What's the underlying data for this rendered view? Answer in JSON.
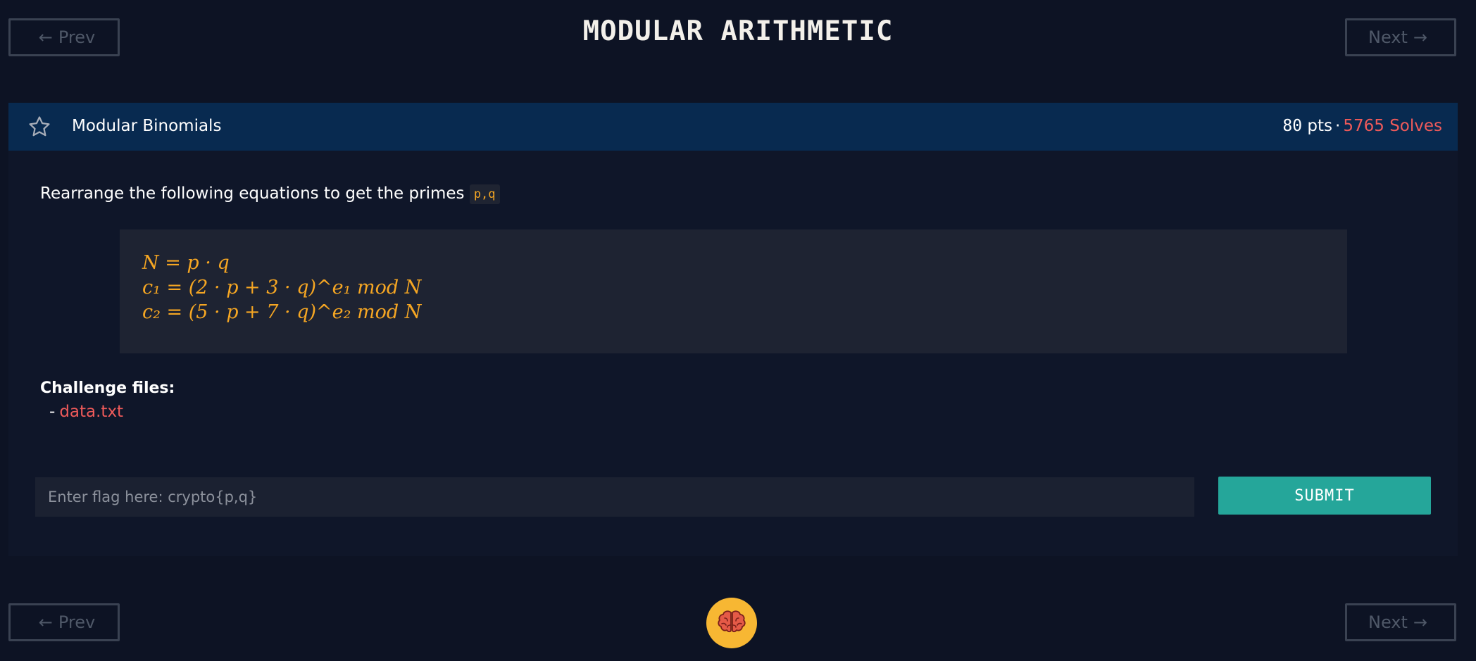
{
  "nav": {
    "prev_label": "Prev",
    "next_label": "Next",
    "prev_arrow": "←",
    "next_arrow": "→"
  },
  "page_title": "MODULAR ARITHMETIC",
  "challenge": {
    "name": "Modular Binomials",
    "points": "80",
    "points_label": "pts",
    "separator": "·",
    "solves": "5765 Solves",
    "description": "Rearrange the following equations to get the primes",
    "inline_code": "p,q",
    "equations": [
      "N = p · q",
      "c₁ = (2 · p + 3 · q)^e₁ mod N",
      "c₂ = (5 · p + 7 · q)^e₂ mod N"
    ],
    "files_title": "Challenge files:",
    "file_dash": "-",
    "files": [
      "data.txt"
    ]
  },
  "flag": {
    "placeholder": "Enter flag here: crypto{p,q}",
    "value": "",
    "submit_label": "SUBMIT"
  },
  "colors": {
    "background": "#0d1324",
    "header": "#082a50",
    "accent_orange": "#f5a623",
    "accent_red": "#ee5a5a",
    "submit": "#25a69a",
    "badge": "#f7b733"
  },
  "icons": {
    "star": "star-icon",
    "brain": "brain-icon"
  }
}
